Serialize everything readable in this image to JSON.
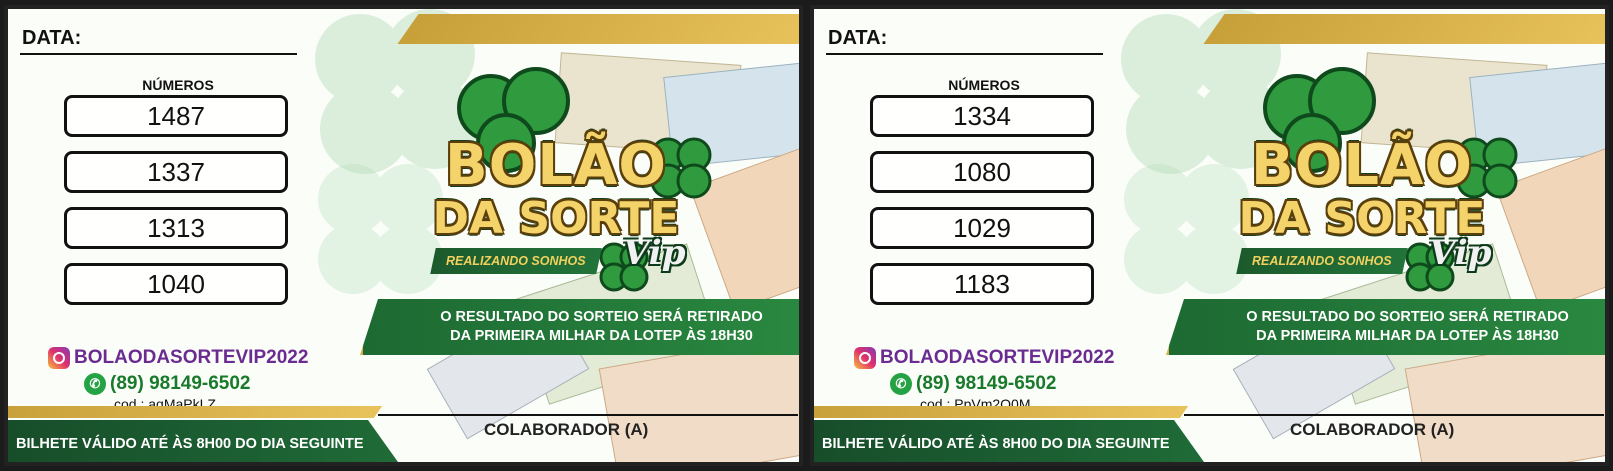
{
  "tickets": [
    {
      "date_label": "DATA:",
      "numbers_title": "NÚMEROS",
      "numbers": [
        "1487",
        "1337",
        "1313",
        "1040"
      ],
      "instagram": "BOLAODASORTEVIP2022",
      "phone": "(89) 98149-6502",
      "code": "cod.: aqMaPkLZ",
      "logo_line1": "BOLÃO",
      "logo_line2": "DA SORTE",
      "logo_vip": "Vip",
      "slogan": "REALIZANDO SONHOS",
      "result_line1": "O RESULTADO DO SORTEIO SERÁ RETIRADO",
      "result_line2": "DA PRIMEIRA MILHAR DA LOTEP ÀS 18H30",
      "collaborator": "COLABORADOR (A)",
      "validity": "BILHETE VÁLIDO ATÉ ÀS 8H00 DO DIA SEGUINTE"
    },
    {
      "date_label": "DATA:",
      "numbers_title": "NÚMEROS",
      "numbers": [
        "1334",
        "1080",
        "1029",
        "1183"
      ],
      "instagram": "BOLAODASORTEVIP2022",
      "phone": "(89) 98149-6502",
      "code": "cod.: PpVm2O0M",
      "logo_line1": "BOLÃO",
      "logo_line2": "DA SORTE",
      "logo_vip": "Vip",
      "slogan": "REALIZANDO SONHOS",
      "result_line1": "O RESULTADO DO SORTEIO SERÁ RETIRADO",
      "result_line2": "DA PRIMEIRA MILHAR DA LOTEP ÀS 18H30",
      "collaborator": "COLABORADOR (A)",
      "validity": "BILHETE VÁLIDO ATÉ ÀS 8H00 DO DIA SEGUINTE"
    }
  ],
  "icons": {
    "instagram": "instagram-icon",
    "whatsapp": "whatsapp-icon",
    "clover": "clover-icon",
    "money": "banknote-stack-icon"
  },
  "colors": {
    "green_dark": "#174d2a",
    "green": "#2a8a40",
    "gold": "#d5b04a",
    "instagram_text": "#6b2c91",
    "whatsapp_text": "#197a2c"
  }
}
